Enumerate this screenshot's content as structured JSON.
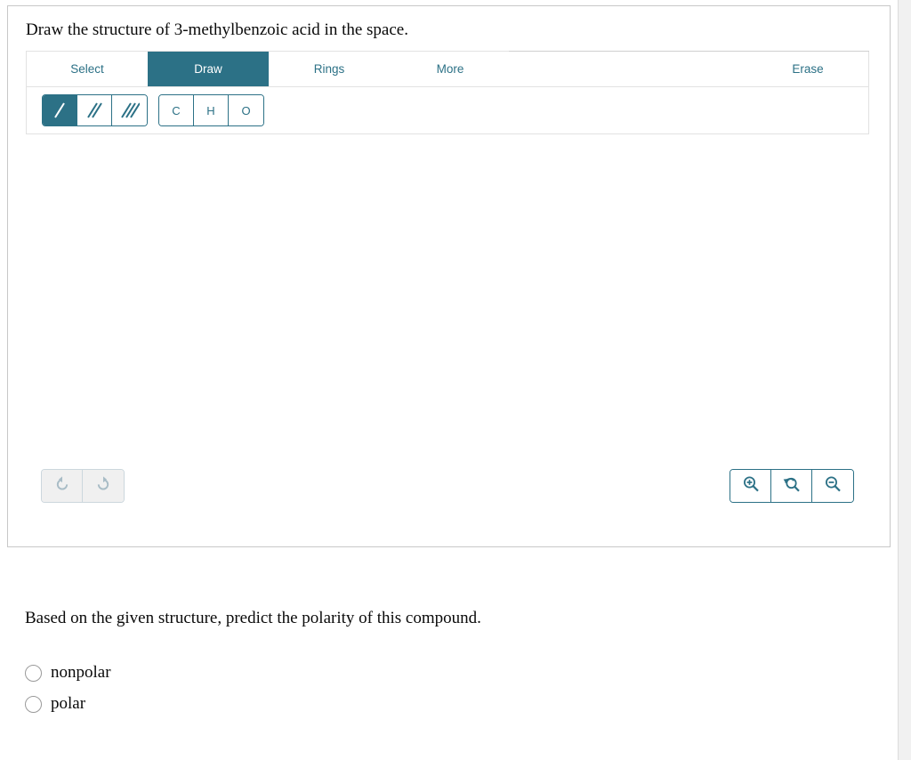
{
  "prompt": {
    "text": "Draw the structure of 3-methylbenzoic acid in the space."
  },
  "editor": {
    "tabs": [
      {
        "label": "Select",
        "name": "tab-select",
        "active": false
      },
      {
        "label": "Draw",
        "name": "tab-draw",
        "active": true
      },
      {
        "label": "Rings",
        "name": "tab-rings",
        "active": false
      },
      {
        "label": "More",
        "name": "tab-more",
        "active": false
      }
    ],
    "erase_label": "Erase",
    "bond_tools": [
      {
        "icon": "single-bond-icon",
        "active": true
      },
      {
        "icon": "double-bond-icon",
        "active": false
      },
      {
        "icon": "triple-bond-icon",
        "active": false
      }
    ],
    "atom_tools": [
      {
        "label": "C",
        "name": "atom-button-carbon"
      },
      {
        "label": "H",
        "name": "atom-button-hydrogen"
      },
      {
        "label": "O",
        "name": "atom-button-oxygen"
      }
    ],
    "history_tools": [
      {
        "icon": "undo-icon",
        "enabled": false
      },
      {
        "icon": "redo-icon",
        "enabled": false
      }
    ],
    "zoom_tools": [
      {
        "icon": "zoom-in-icon"
      },
      {
        "icon": "zoom-reset-icon"
      },
      {
        "icon": "zoom-out-icon"
      }
    ],
    "canvas_content": ""
  },
  "polarity": {
    "question": "Based on the given structure, predict the polarity of this compound.",
    "options": [
      {
        "label": "nonpolar",
        "selected": false
      },
      {
        "label": "polar",
        "selected": false
      }
    ]
  },
  "colors": {
    "accent": "#2c7186",
    "card_border": "#c8c8c8",
    "tab_border": "#e2e2e2",
    "disabled_bg": "#f0f0f0",
    "disabled_fg": "#a8bcc6",
    "radio_border": "#9a9a9a",
    "scrollbar_track": "#f1f1f1"
  }
}
